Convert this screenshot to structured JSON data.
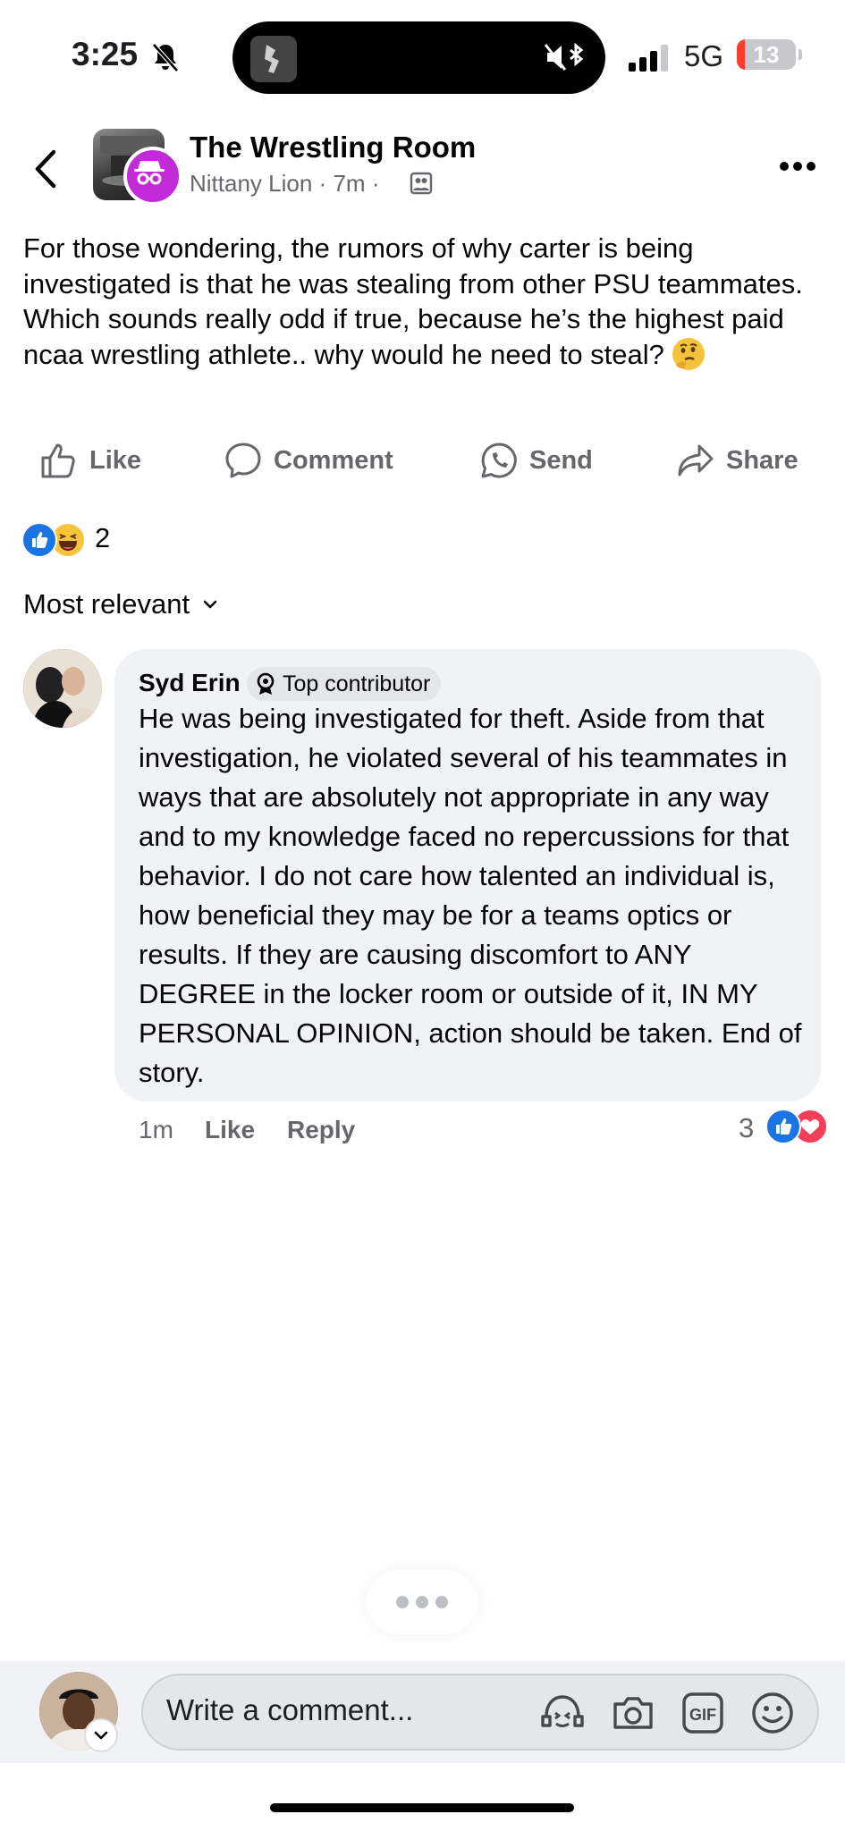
{
  "status_bar": {
    "time": "3:25",
    "network": "5G",
    "battery": "13",
    "battery_level_percent": 13
  },
  "header": {
    "group_name": "The Wrestling Room",
    "author": "Nittany Lion",
    "age": "7m",
    "meta_separator": "·"
  },
  "post": {
    "text": "For those wondering, the rumors of why carter is being investigated is that he was stealing from other PSU teammates. Which sounds really odd if true, because he’s the highest paid ncaa wrestling athlete.. why would he need to steal?",
    "emoji_icon": "thinking-face-icon"
  },
  "actions": {
    "like": "Like",
    "comment": "Comment",
    "send": "Send",
    "share": "Share"
  },
  "reactions": {
    "count": "2",
    "types": [
      "like",
      "haha"
    ]
  },
  "sort": {
    "label": "Most relevant"
  },
  "comments": [
    {
      "author": "Syd Erin",
      "badge": "Top contributor",
      "text": "He was being investigated for theft. Aside from that investigation, he violated several of his teammates in ways that are absolutely not appropriate in any way and to my knowledge faced no repercussions for that behavior. I do not care how talented an individual is, how beneficial they may be for a teams optics or results. If they are causing discomfort to ANY DEGREE in the locker room or outside of it, IN MY PERSONAL OPINION, action should be taken. End of story.",
      "age": "1m",
      "like_label": "Like",
      "reply_label": "Reply",
      "reaction_count": "3",
      "reaction_types": [
        "like",
        "love"
      ]
    }
  ],
  "composer": {
    "placeholder": "Write a comment...",
    "icons": [
      "avatar-sticker-icon",
      "camera-icon",
      "gif-icon",
      "emoji-icon"
    ],
    "gif_label": "GIF"
  },
  "colors": {
    "like_blue": "#1b74e4",
    "love_red": "#f33e58",
    "anon_badge_purple": "#c32ad8",
    "secondary_text": "#65676b",
    "bubble_gray": "#f0f2f5"
  }
}
